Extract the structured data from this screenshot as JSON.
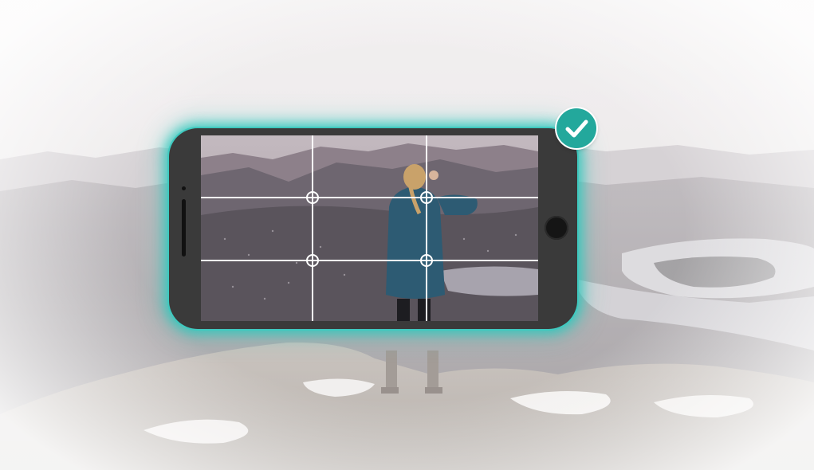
{
  "scene": {
    "background_icon": "mountain-landscape",
    "subject_icon": "person-standing"
  },
  "phone": {
    "icon": "smartphone-landscape",
    "frame_color": "#3a3a3a",
    "glow_color": "#2fc8bc"
  },
  "camera_view": {
    "grid": "rule-of-thirds",
    "grid_color": "#ffffff",
    "focus_point_icon": "crosshair-circle"
  },
  "badge": {
    "icon": "checkmark",
    "color": "#23a89c"
  }
}
